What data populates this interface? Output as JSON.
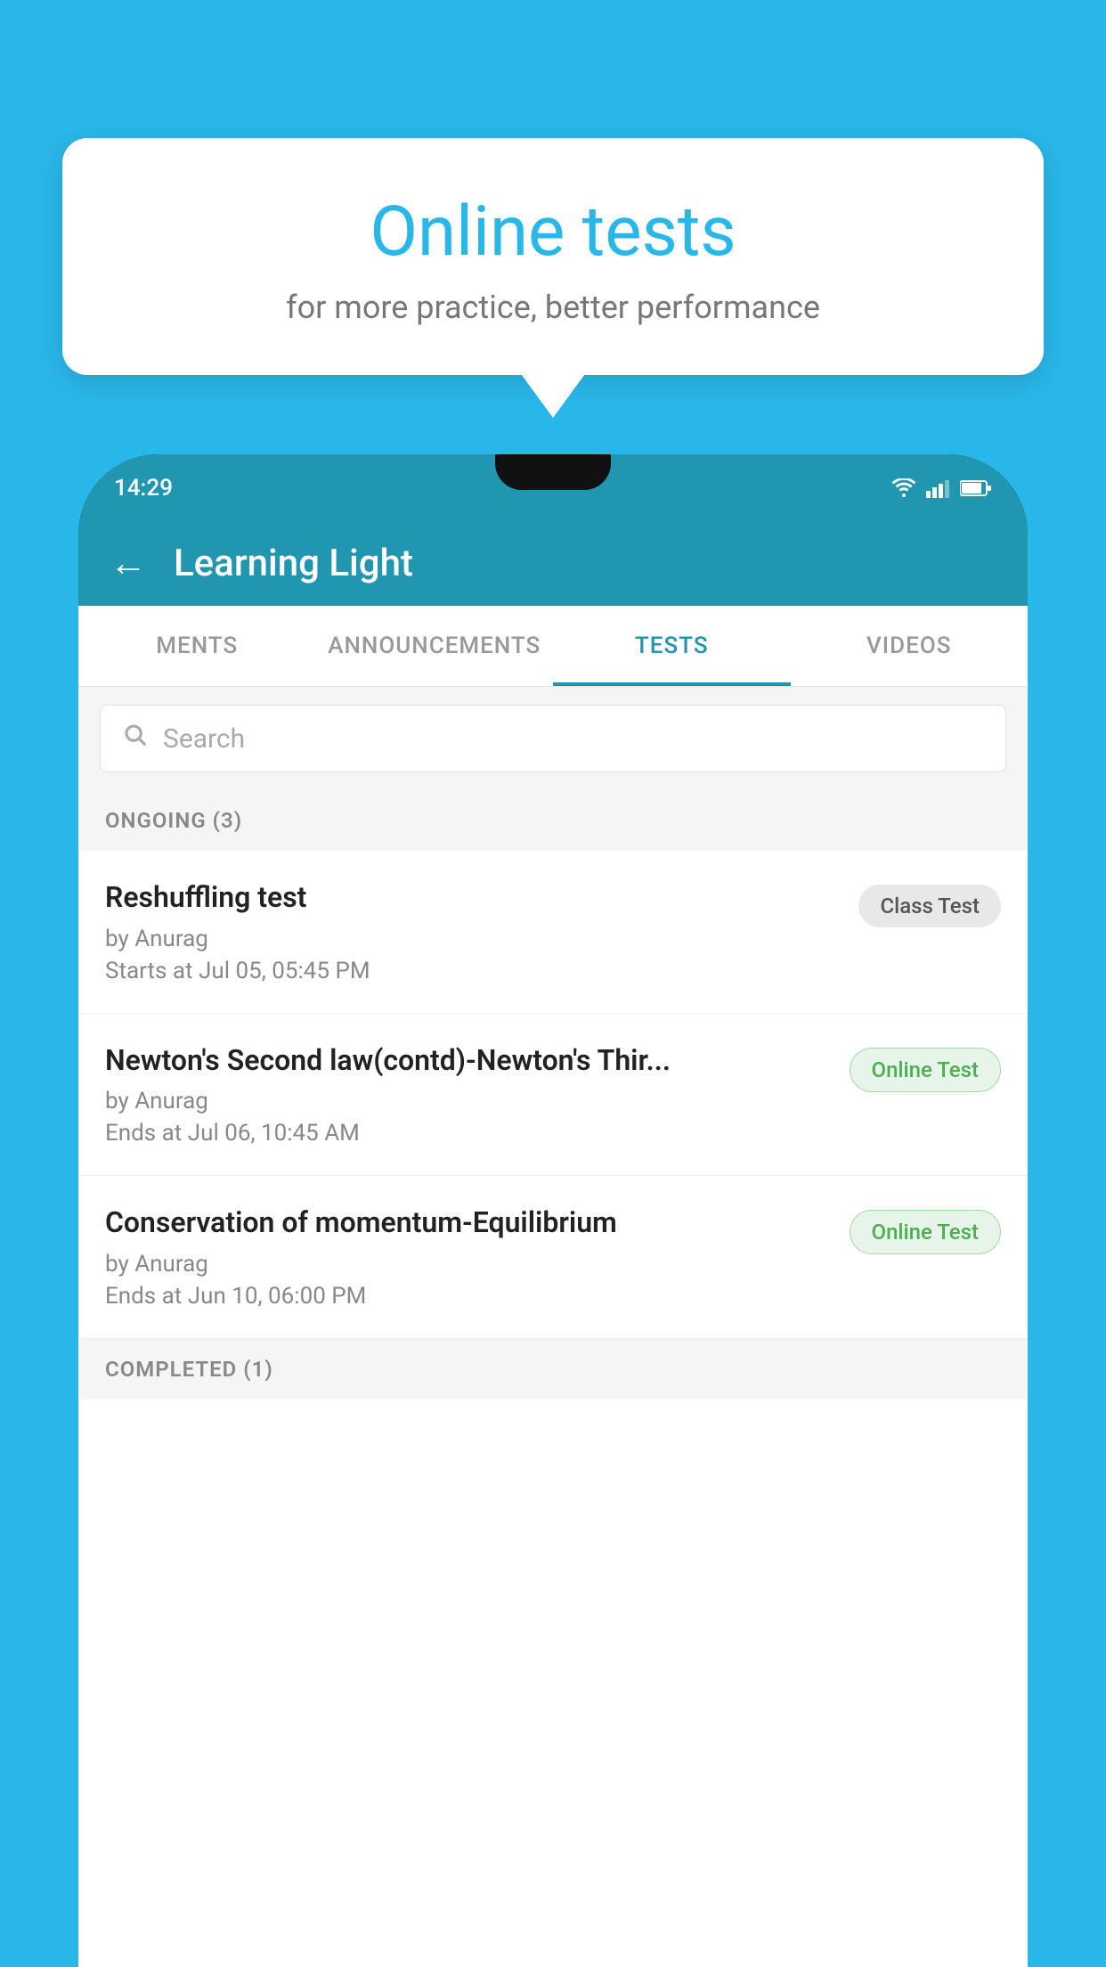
{
  "background_color": "#29b6e8",
  "bubble": {
    "title": "Online tests",
    "subtitle": "for more practice, better performance"
  },
  "phone": {
    "status_bar": {
      "time": "14:29"
    },
    "header": {
      "back_label": "←",
      "title": "Learning Light"
    },
    "tabs": [
      {
        "label": "MENTS",
        "active": false
      },
      {
        "label": "ANNOUNCEMENTS",
        "active": false
      },
      {
        "label": "TESTS",
        "active": true
      },
      {
        "label": "VIDEOS",
        "active": false
      }
    ],
    "search": {
      "placeholder": "Search"
    },
    "ongoing_section": {
      "label": "ONGOING (3)"
    },
    "tests": [
      {
        "name": "Reshuffling test",
        "author": "by Anurag",
        "date_label": "Starts at",
        "date": "Jul 05, 05:45 PM",
        "badge": "Class Test",
        "badge_type": "class"
      },
      {
        "name": "Newton's Second law(contd)-Newton's Thir...",
        "author": "by Anurag",
        "date_label": "Ends at",
        "date": "Jul 06, 10:45 AM",
        "badge": "Online Test",
        "badge_type": "online"
      },
      {
        "name": "Conservation of momentum-Equilibrium",
        "author": "by Anurag",
        "date_label": "Ends at",
        "date": "Jun 10, 06:00 PM",
        "badge": "Online Test",
        "badge_type": "online"
      }
    ],
    "completed_section": {
      "label": "COMPLETED (1)"
    }
  }
}
